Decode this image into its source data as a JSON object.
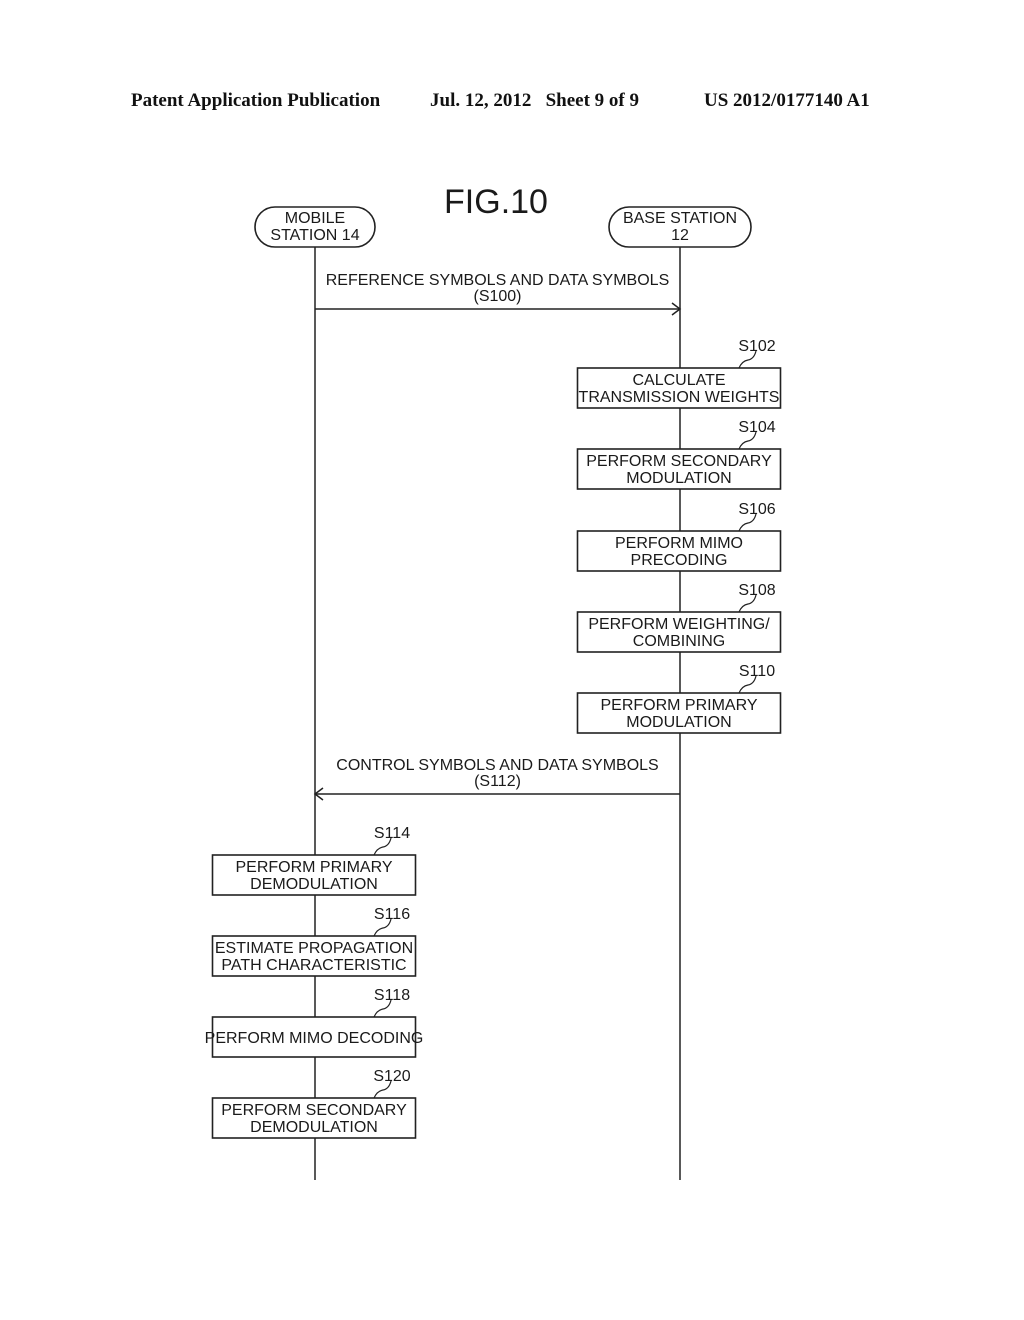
{
  "header": {
    "publication": "Patent Application Publication",
    "date_sheet": "Jul. 12, 2012   Sheet 9 of 9",
    "number": "US 2012/0177140 A1"
  },
  "figure": {
    "title": "FIG.10",
    "lifelines": [
      {
        "id": "mobile",
        "lines": [
          "MOBILE",
          "STATION 14"
        ]
      },
      {
        "id": "base",
        "lines": [
          "BASE STATION",
          "12"
        ]
      }
    ],
    "messages": [
      {
        "id": "S100",
        "from": "mobile",
        "to": "base",
        "lines": [
          "REFERENCE SYMBOLS AND DATA SYMBOLS",
          "(S100)"
        ]
      },
      {
        "id": "S112",
        "from": "base",
        "to": "mobile",
        "lines": [
          "CONTROL SYMBOLS AND DATA SYMBOLS",
          "(S112)"
        ]
      }
    ],
    "steps": [
      {
        "step": "S102",
        "lifeline": "base",
        "lines": [
          "CALCULATE",
          "TRANSMISSION WEIGHTS"
        ]
      },
      {
        "step": "S104",
        "lifeline": "base",
        "lines": [
          "PERFORM SECONDARY",
          "MODULATION"
        ]
      },
      {
        "step": "S106",
        "lifeline": "base",
        "lines": [
          "PERFORM MIMO",
          "PRECODING"
        ]
      },
      {
        "step": "S108",
        "lifeline": "base",
        "lines": [
          "PERFORM WEIGHTING/",
          "COMBINING"
        ]
      },
      {
        "step": "S110",
        "lifeline": "base",
        "lines": [
          "PERFORM PRIMARY",
          "MODULATION"
        ]
      },
      {
        "step": "S114",
        "lifeline": "mobile",
        "lines": [
          "PERFORM PRIMARY",
          "DEMODULATION"
        ]
      },
      {
        "step": "S116",
        "lifeline": "mobile",
        "lines": [
          "ESTIMATE PROPAGATION",
          "PATH CHARACTERISTIC"
        ]
      },
      {
        "step": "S118",
        "lifeline": "mobile",
        "lines": [
          "PERFORM MIMO DECODING"
        ]
      },
      {
        "step": "S120",
        "lifeline": "mobile",
        "lines": [
          "PERFORM SECONDARY",
          "DEMODULATION"
        ]
      }
    ]
  }
}
